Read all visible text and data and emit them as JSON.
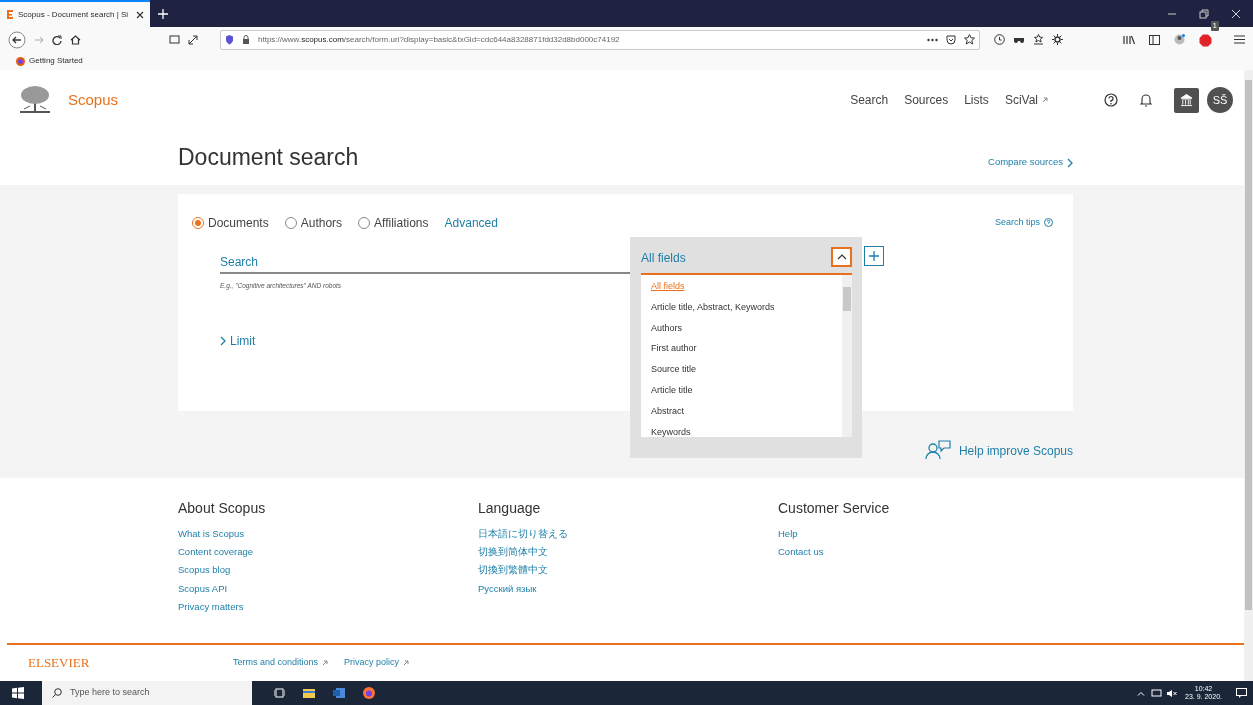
{
  "browser": {
    "tab_title": "Scopus - Document search | Si",
    "url_prefix": "https://www.",
    "url_host": "scopus.com",
    "url_path": "/search/form.uri?display=basic&txGid=cdc644a8328871fdd32d8bd000c74192",
    "bookmarks": [
      "Getting Started"
    ],
    "extension_badge": "1"
  },
  "header": {
    "brand": "Scopus",
    "nav": [
      {
        "label": "Search",
        "external": false
      },
      {
        "label": "Sources",
        "external": false
      },
      {
        "label": "Lists",
        "external": false
      },
      {
        "label": "SciVal",
        "external": true
      }
    ],
    "avatar": "SŠ"
  },
  "page_title": "Document search",
  "compare_link": "Compare sources",
  "search_types": [
    {
      "label": "Documents",
      "selected": true
    },
    {
      "label": "Authors",
      "selected": false
    },
    {
      "label": "Affiliations",
      "selected": false
    }
  ],
  "advanced_link": "Advanced",
  "search_tips": "Search tips",
  "search": {
    "placeholder": "Search",
    "hint": "E.g., \"Cognitive architectures\" AND robots"
  },
  "field_select": {
    "value": "All fields",
    "expanded": true,
    "options": [
      {
        "label": "All fields",
        "selected": true
      },
      {
        "label": "Article title, Abstract, Keywords",
        "selected": false
      },
      {
        "label": "Authors",
        "selected": false
      },
      {
        "label": "First author",
        "selected": false
      },
      {
        "label": "Source title",
        "selected": false
      },
      {
        "label": "Article title",
        "selected": false
      },
      {
        "label": "Abstract",
        "selected": false
      },
      {
        "label": "Keywords",
        "selected": false
      }
    ]
  },
  "limit": "Limit",
  "help_link": "Help improve Scopus",
  "footer_columns": [
    {
      "heading": "About Scopus",
      "links": [
        "What is Scopus",
        "Content coverage",
        "Scopus blog",
        "Scopus API",
        "Privacy matters"
      ]
    },
    {
      "heading": "Language",
      "links": [
        "日本語に切り替える",
        "切换到简体中文",
        "切換到繁體中文",
        "Русский язык"
      ]
    },
    {
      "heading": "Customer Service",
      "links": [
        "Help",
        "Contact us"
      ]
    }
  ],
  "footer_bottom": {
    "brand": "ELSEVIER",
    "links": [
      "Terms and conditions",
      "Privacy policy"
    ]
  },
  "taskbar": {
    "search_placeholder": "Type here to search",
    "time": "10:42",
    "date": "23. 9. 2020."
  }
}
